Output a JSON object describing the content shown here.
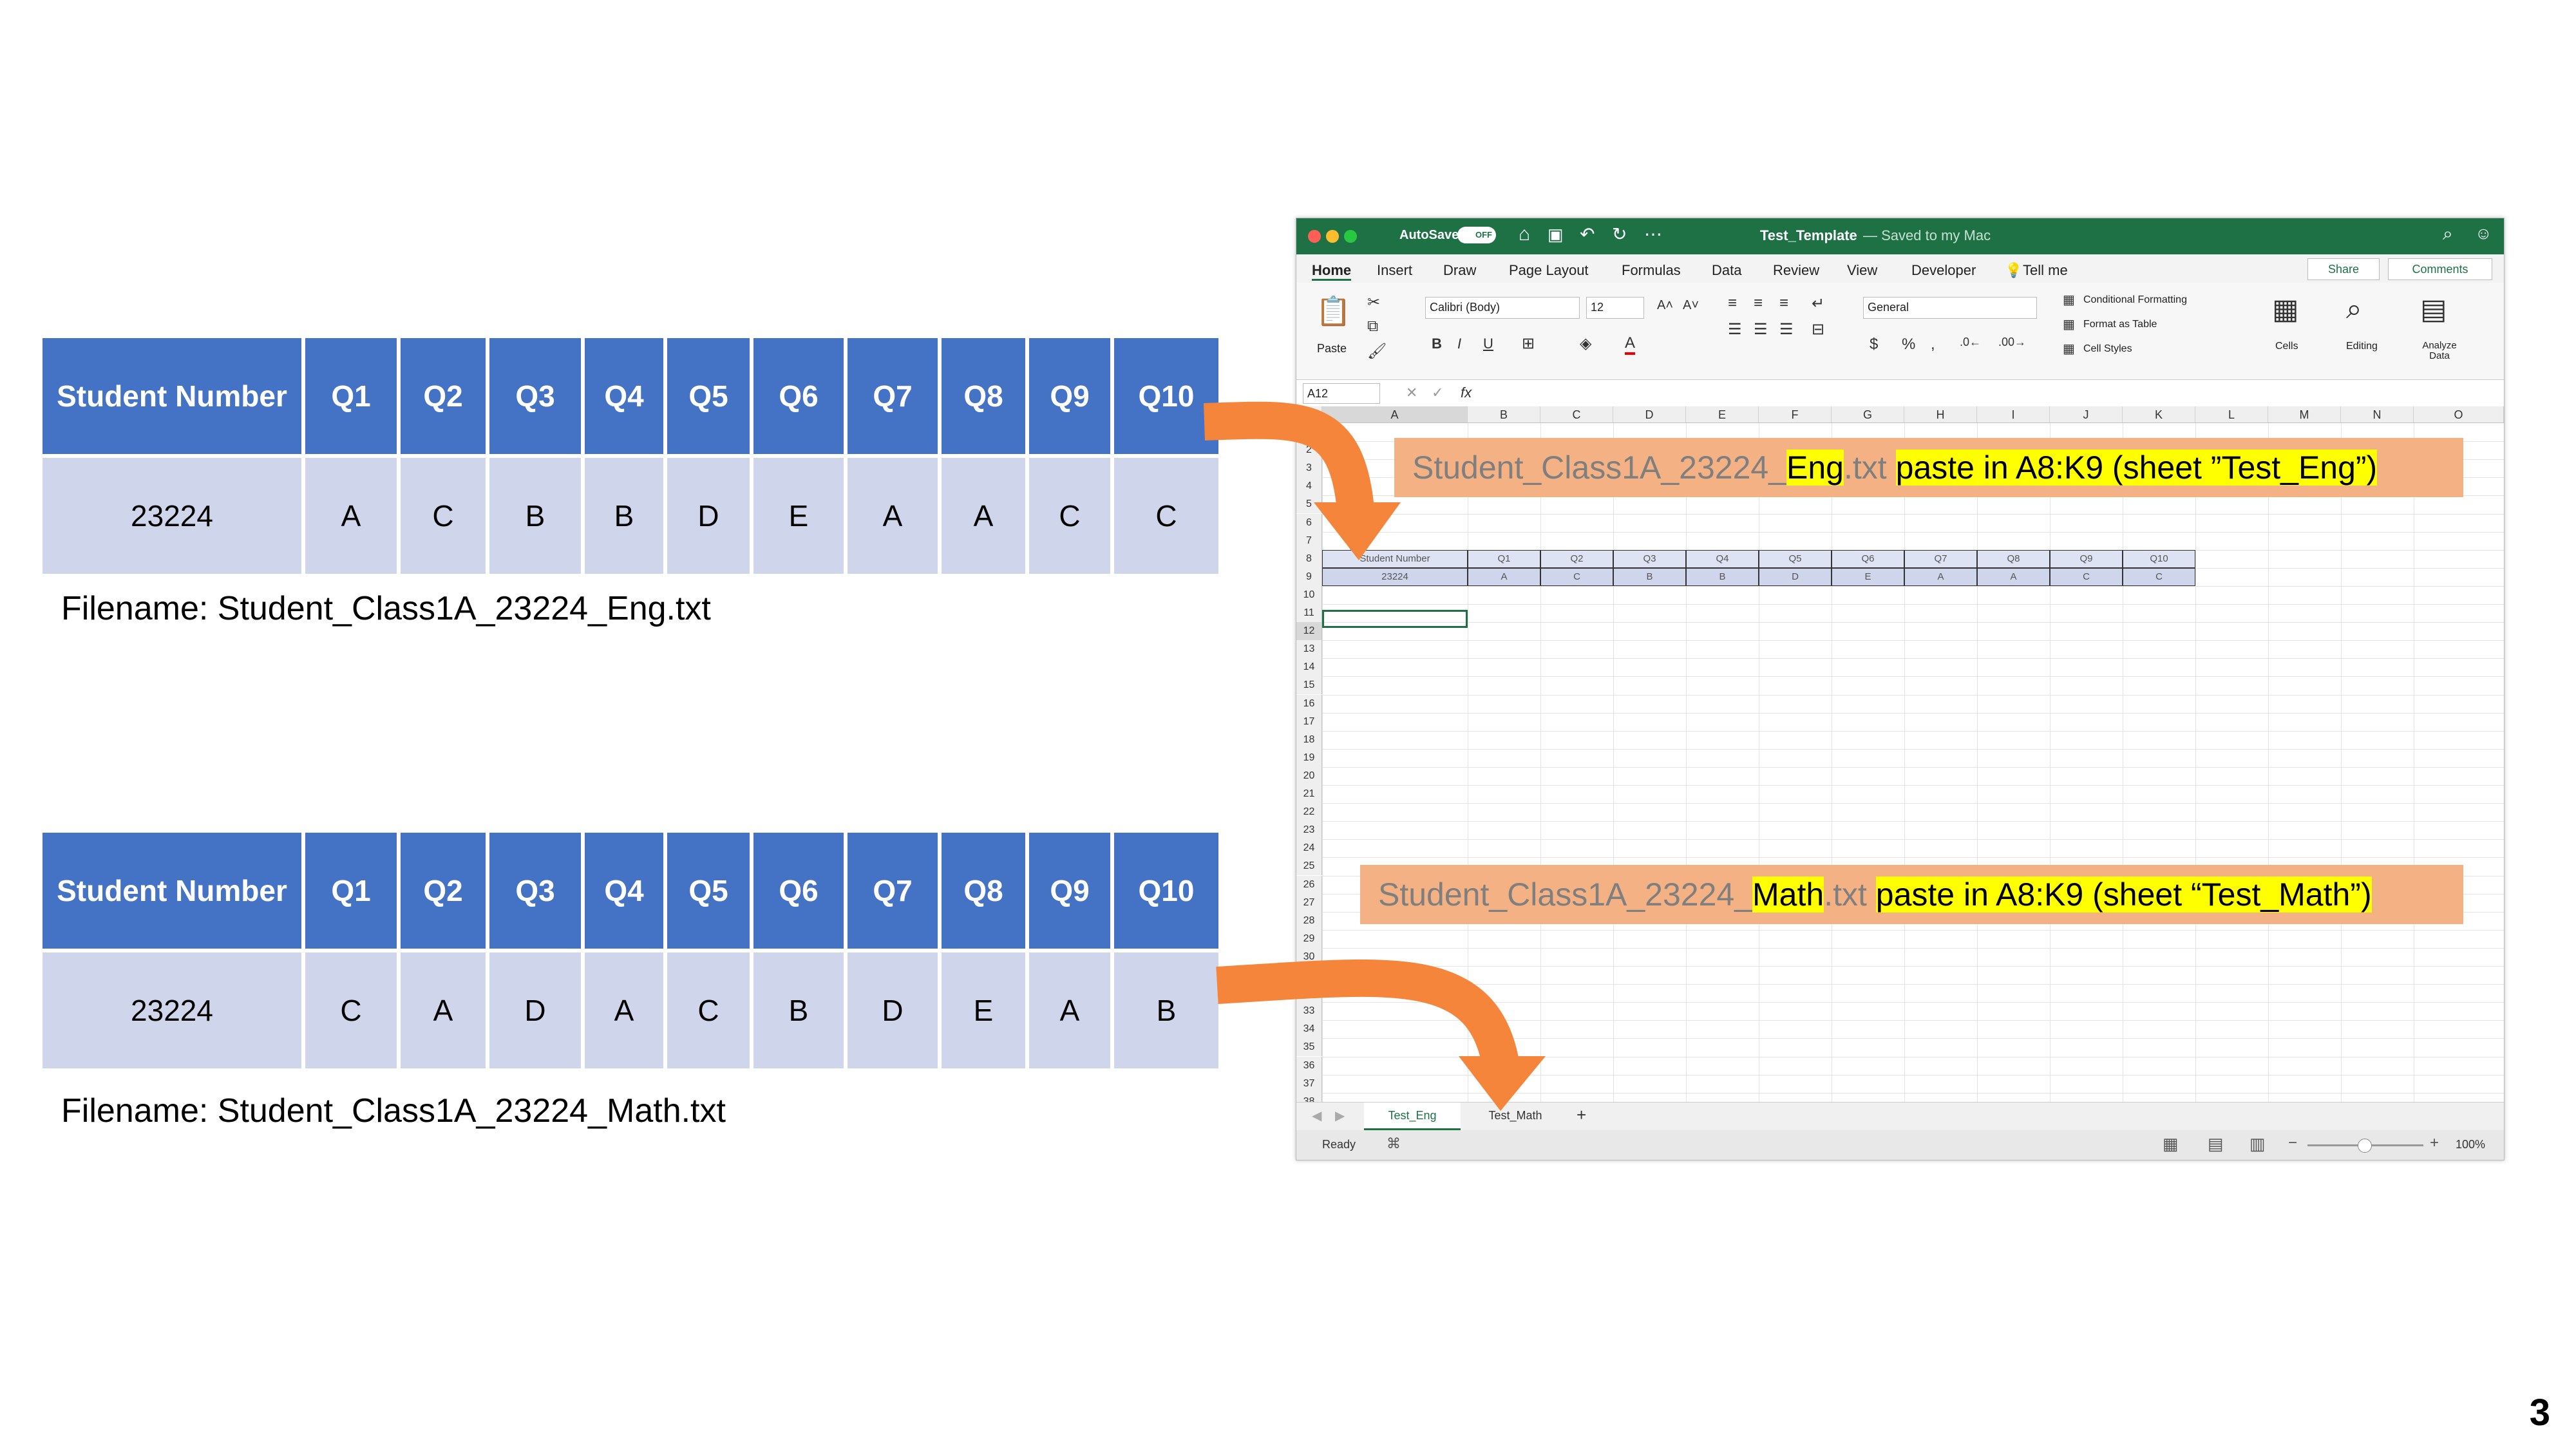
{
  "tables": [
    {
      "header": [
        "Student Number",
        "Q1",
        "Q2",
        "Q3",
        "Q4",
        "Q5",
        "Q6",
        "Q7",
        "Q8",
        "Q9",
        "Q10"
      ],
      "row": [
        "23224",
        "A",
        "C",
        "B",
        "B",
        "D",
        "E",
        "A",
        "A",
        "C",
        "C"
      ],
      "filename": "Filename: Student_Class1A_23224_Eng.txt"
    },
    {
      "header": [
        "Student Number",
        "Q1",
        "Q2",
        "Q3",
        "Q4",
        "Q5",
        "Q6",
        "Q7",
        "Q8",
        "Q9",
        "Q10"
      ],
      "row": [
        "23224",
        "C",
        "A",
        "D",
        "A",
        "C",
        "B",
        "D",
        "E",
        "A",
        "B"
      ],
      "filename": "Filename: Student_Class1A_23224_Math.txt"
    }
  ],
  "excel": {
    "autosave": "AutoSave",
    "autosave_state": "OFF",
    "title": "Test_Template",
    "saved": "— Saved to my Mac",
    "ribbon_tabs": [
      "Home",
      "Insert",
      "Draw",
      "Page Layout",
      "Formulas",
      "Data",
      "Review",
      "View",
      "Developer",
      "Tell me"
    ],
    "share": "Share",
    "comments": "Comments",
    "paste": "Paste",
    "font": "Calibri (Body)",
    "font_size": "12",
    "number_format": "General",
    "conditional_formatting": "Conditional Formatting",
    "format_as_table": "Format as Table",
    "cell_styles": "Cell Styles",
    "cells": "Cells",
    "editing": "Editing",
    "analyze_data": "Analyze Data",
    "name_box": "A12",
    "fx": "fx",
    "columns": [
      "A",
      "B",
      "C",
      "D",
      "E",
      "F",
      "G",
      "H",
      "I",
      "J",
      "K",
      "L",
      "M",
      "N",
      "O"
    ],
    "mini_header": [
      "Student Number",
      "Q1",
      "Q2",
      "Q3",
      "Q4",
      "Q5",
      "Q6",
      "Q7",
      "Q8",
      "Q9",
      "Q10"
    ],
    "mini_row": [
      "23224",
      "A",
      "C",
      "B",
      "B",
      "D",
      "E",
      "A",
      "A",
      "C",
      "C"
    ],
    "sheet_tabs": [
      "Test_Eng",
      "Test_Math"
    ],
    "add_sheet": "+",
    "status": "Ready",
    "zoom": "100%"
  },
  "callouts": {
    "eng": {
      "prefix": "Student_Class1A_23224_",
      "subject": "Eng",
      "ext": ".txt",
      "instr": "paste in A8:K9 (sheet ”Test_Eng”)"
    },
    "math": {
      "prefix": "Student_Class1A_23224_",
      "subject": "Math",
      "ext": ".txt",
      "instr": "paste in A8:K9 (sheet “Test_Math”)"
    }
  },
  "page_number": "3",
  "colors": {
    "header_blue": "#4472c4",
    "row_lavender": "#cfd5ea",
    "callout_orange": "#f4b183",
    "arrow_orange": "#f5853a",
    "excel_green": "#1e7145",
    "highlight": "#ffff00"
  }
}
